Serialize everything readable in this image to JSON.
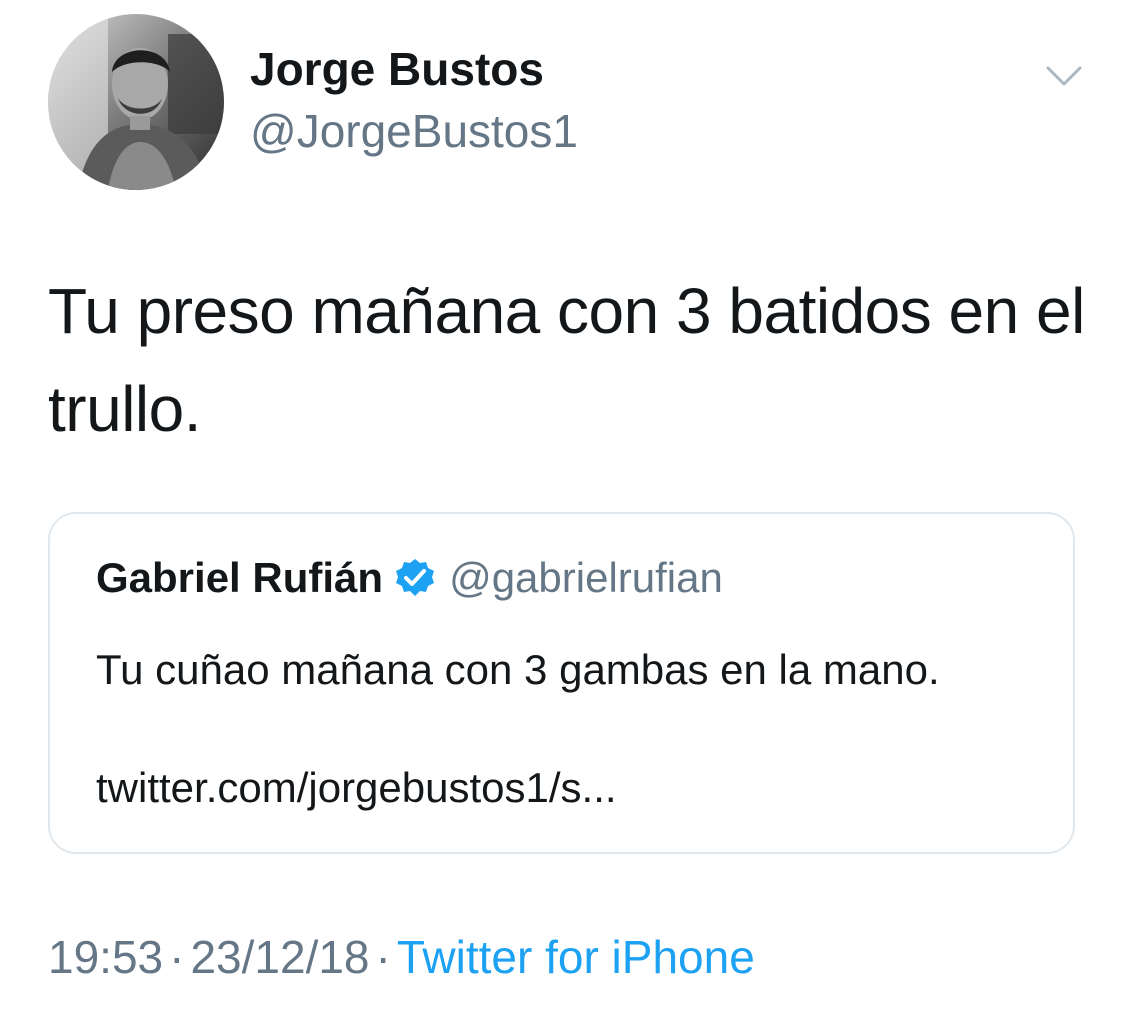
{
  "author": {
    "name": "Jorge Bustos",
    "handle": "@JorgeBustos1",
    "avatar_icon": "profile-photo"
  },
  "menu": {
    "icon": "chevron-down-icon"
  },
  "tweet": {
    "text": "Tu preso mañana con 3 batidos en el trullo."
  },
  "quoted_tweet": {
    "name": "Gabriel Rufián",
    "verified_icon": "verified-badge-icon",
    "handle": "@gabrielrufian",
    "text": "Tu cuñao mañana con 3 gambas en la mano.",
    "link": "twitter.com/jorgebustos1/s..."
  },
  "meta": {
    "time": "19:53",
    "separator": "·",
    "date": "23/12/18",
    "source": "Twitter for iPhone"
  },
  "colors": {
    "text": "#14171a",
    "secondary": "#657786",
    "link": "#1da1f2",
    "border": "#e1e8ed",
    "verified": "#1da1f2"
  }
}
